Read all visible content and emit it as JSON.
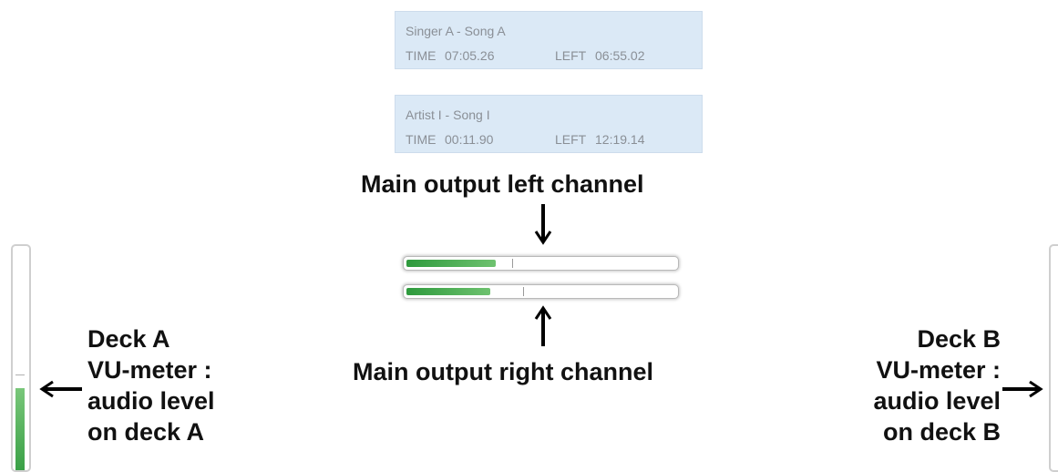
{
  "deck_a_card": {
    "title": "Singer A - Song A",
    "time_label": "TIME",
    "time_value": "07:05.26",
    "left_label": "LEFT",
    "left_value": "06:55.02"
  },
  "deck_b_card": {
    "title": "Artist I - Song I",
    "time_label": "TIME",
    "time_value": "00:11.90",
    "left_label": "LEFT",
    "left_value": "12:19.14"
  },
  "annotations": {
    "main_left": "Main output left channel",
    "main_right": "Main output right channel",
    "deck_a_lines": [
      "Deck A",
      "VU-meter :",
      "audio level",
      "on deck A"
    ],
    "deck_b_lines": [
      "Deck B",
      "VU-meter :",
      "audio level",
      "on deck B"
    ]
  },
  "meters": {
    "master_left_level": 0.33,
    "master_left_peak": 0.39,
    "master_right_level": 0.31,
    "master_right_peak": 0.43,
    "deck_a_level": 0.38,
    "deck_a_peak": 0.44,
    "deck_b_level": 0.0
  },
  "colors": {
    "card_bg": "#dbe9f6",
    "card_text": "#8a8f96",
    "meter_green": "#4caf50"
  }
}
